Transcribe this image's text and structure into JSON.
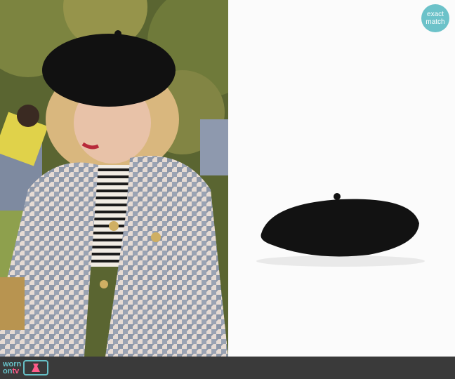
{
  "badge": {
    "line1": "exact",
    "line2": "match"
  },
  "logo": {
    "worn": "worn",
    "on": "on",
    "tv": "tv"
  },
  "icons": {
    "logo_mark": "tv-dress-icon"
  },
  "colors": {
    "accent": "#67c0c6",
    "badge": "#6cc2c9",
    "footer": "#3a3a3a",
    "beret": "#121212"
  }
}
